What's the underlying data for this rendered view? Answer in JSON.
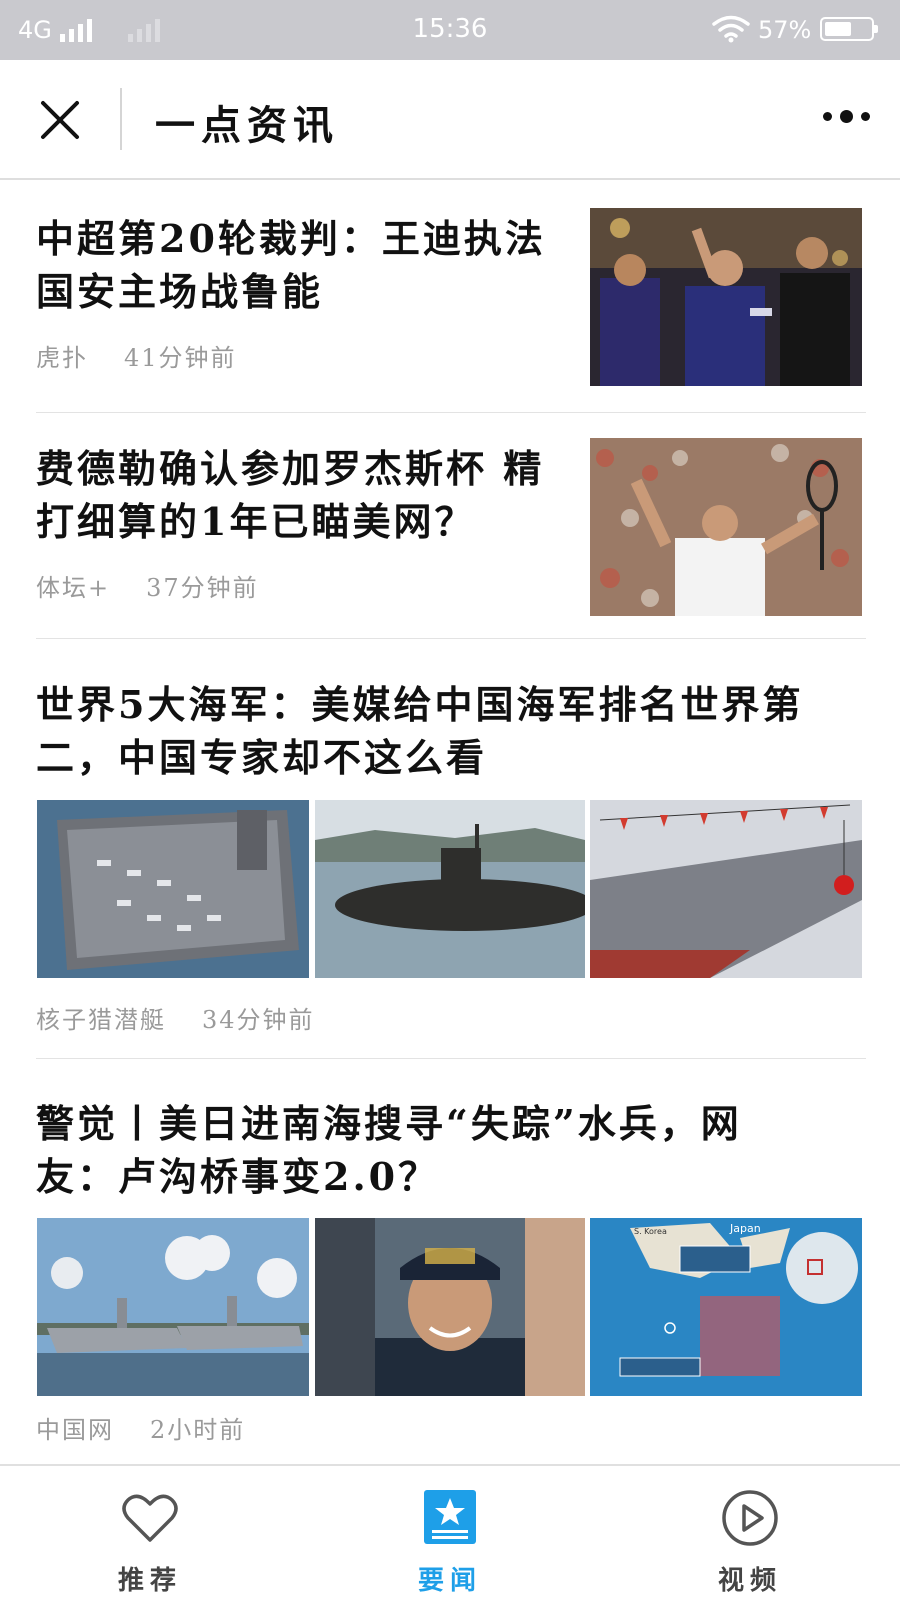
{
  "status_bar": {
    "network": "4G",
    "time": "15:36",
    "battery_percent": "57%",
    "battery_level": 0.57
  },
  "header": {
    "title": "一点资讯"
  },
  "articles": [
    {
      "headline_lines": [
        "中超第20轮裁判：王迪执法",
        "国安主场战鲁能"
      ],
      "source": "虎扑",
      "time": "41分钟前"
    },
    {
      "headline_lines": [
        "费德勒确认参加罗杰斯杯 精",
        "打细算的1年已瞄美网？"
      ],
      "source": "体坛+",
      "time": "37分钟前"
    },
    {
      "headline_lines": [
        "世界5大海军：美媒给中国海军排名世界第",
        "二，中国专家却不这么看"
      ],
      "source": "核子猎潜艇",
      "time": "34分钟前"
    },
    {
      "headline_lines": [
        "警觉丨美日进南海搜寻“失踪”水兵，网",
        "友：卢沟桥事变2.0？"
      ],
      "source": "中国网",
      "time": "2小时前"
    }
  ],
  "map_labels": {
    "country1": "Japan",
    "country2": "S. Korea"
  },
  "tabs": [
    {
      "label": "推荐",
      "icon": "heart-icon"
    },
    {
      "label": "要闻",
      "icon": "star-news-icon"
    },
    {
      "label": "视频",
      "icon": "play-icon"
    }
  ],
  "colors": {
    "accent": "#1e9fe8",
    "status_bar": "#c9c9ce",
    "meta_text": "#9a9a9a"
  }
}
